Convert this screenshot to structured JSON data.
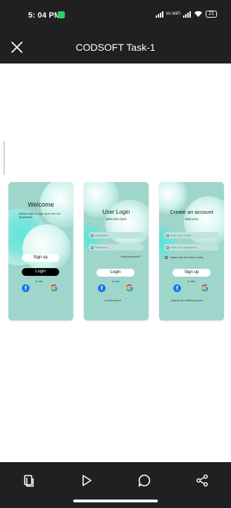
{
  "status_bar": {
    "time": "5: 04 PM",
    "network_label": "Vo WiFi",
    "battery": "21",
    "icons": [
      "message-icon",
      "signal-icon",
      "wifi-icon",
      "battery-icon"
    ]
  },
  "app_bar": {
    "title": "CODSOFT Task-1",
    "close_icon": "close-icon"
  },
  "preview": {
    "welcome": {
      "title": "Welcome",
      "subtitle": "please login or sign up to use our application",
      "signup_label": "Sign up",
      "login_label": "Login",
      "or_with": "or with"
    },
    "login": {
      "title": "User Login",
      "subtitle": "Welcome back",
      "username_placeholder": "Username",
      "password_placeholder": "Password",
      "forgot": "Forgot password?",
      "login_label": "Login",
      "or_with": "or with",
      "create_account": "Create account"
    },
    "signup": {
      "title": "Create an account",
      "subtitle": "Welcome",
      "email_placeholder": "Enter your email",
      "password_placeholder": "Enter your password",
      "agree": "I agree with the terms & policy",
      "signup_label": "Sign up",
      "or_with": "or with",
      "login_existing": "Login to the existing account"
    }
  },
  "colors": {
    "card_bg": "#9fd6cc",
    "bubble": "#56e7dd",
    "bar_bg": "#202020"
  },
  "nav": {
    "icons": [
      "document-icon",
      "play-icon",
      "comment-icon",
      "share-icon"
    ]
  }
}
